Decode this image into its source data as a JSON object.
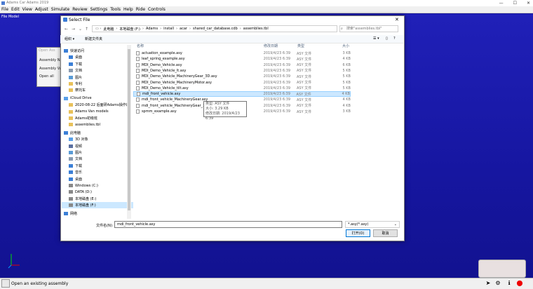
{
  "app": {
    "title": "Adams Car Adams 2019",
    "menu": [
      "File",
      "Edit",
      "View",
      "Adjust",
      "Simulate",
      "Review",
      "Settings",
      "Tools",
      "Help",
      "Ride",
      "Controls"
    ],
    "viewport_label": "File Model",
    "status_text": "Open an existing assembly"
  },
  "bg_dialog": {
    "title": "Open Ass",
    "line1": "Assembly Na",
    "line2": "Assembly Va",
    "line3": "Open all"
  },
  "dialog": {
    "title": "Select File",
    "breadcrumb": [
      "此电脑",
      "本地磁盘 (F:)",
      "Adams",
      "install",
      "acar",
      "shared_car_database.cdb",
      "assemblies.tbl"
    ],
    "search_placeholder": "搜索\"assemblies.tbl\"",
    "toolbar": {
      "organize": "组织 ▾",
      "new_folder": "新建文件夹"
    },
    "sidebar": [
      {
        "label": "快速访问",
        "icon": "star-icon"
      },
      {
        "label": "桌面",
        "icon": "desktop-icon"
      },
      {
        "label": "下载",
        "icon": "download-icon"
      },
      {
        "label": "文档",
        "icon": "document-icon"
      },
      {
        "label": "图片",
        "icon": "picture-icon"
      },
      {
        "label": "专利",
        "icon": "folder-icon"
      },
      {
        "label": "摩托车",
        "icon": "folder-icon"
      },
      {
        "label": "iCloud Drive",
        "icon": "cloud-icon"
      },
      {
        "label": "2020-08-22 后面研Adams操作的",
        "icon": "folder-icon"
      },
      {
        "label": "Adams Van models",
        "icon": "folder-icon"
      },
      {
        "label": "Adams初级班",
        "icon": "folder-icon"
      },
      {
        "label": "assemblies.tbl",
        "icon": "folder-icon"
      },
      {
        "label": "此电脑",
        "icon": "computer-icon"
      },
      {
        "label": "3D 对象",
        "icon": "cube-icon"
      },
      {
        "label": "视频",
        "icon": "video-icon"
      },
      {
        "label": "图片",
        "icon": "picture-icon"
      },
      {
        "label": "文档",
        "icon": "document-icon"
      },
      {
        "label": "下载",
        "icon": "download-icon"
      },
      {
        "label": "音乐",
        "icon": "music-icon"
      },
      {
        "label": "桌面",
        "icon": "desktop-icon"
      },
      {
        "label": "Windows (C:)",
        "icon": "drive-icon"
      },
      {
        "label": "DATA (D:)",
        "icon": "drive-icon"
      },
      {
        "label": "本地磁盘 (E:)",
        "icon": "drive-icon"
      },
      {
        "label": "本地磁盘 (F:)",
        "icon": "drive-icon"
      },
      {
        "label": "网络",
        "icon": "network-icon"
      }
    ],
    "columns": {
      "name": "名称",
      "date": "修改日期",
      "type": "类型",
      "size": "大小"
    },
    "files": [
      {
        "name": "actuation_example.asy",
        "date": "2019/4/23 6:39",
        "type": "ASY 文件",
        "size": "3 KB"
      },
      {
        "name": "leaf_spring_example.asy",
        "date": "2019/4/23 6:39",
        "type": "ASY 文件",
        "size": "4 KB"
      },
      {
        "name": "MDI_Demo_Vehicle.asy",
        "date": "2019/4/23 6:39",
        "type": "ASY 文件",
        "size": "6 KB"
      },
      {
        "name": "MDI_Demo_Vehicle_lt.asy",
        "date": "2019/4/23 6:39",
        "type": "ASY 文件",
        "size": "5 KB"
      },
      {
        "name": "MDI_Demo_Vehicle_MachineryGear_3D.asy",
        "date": "2019/4/23 6:39",
        "type": "ASY 文件",
        "size": "5 KB"
      },
      {
        "name": "MDI_Demo_Vehicle_MachineryMotor.asy",
        "date": "2019/4/23 6:39",
        "type": "ASY 文件",
        "size": "5 KB"
      },
      {
        "name": "MDI_Demo_Vehicle_tilt.asy",
        "date": "2019/4/23 6:39",
        "type": "ASY 文件",
        "size": "5 KB"
      },
      {
        "name": "mdi_front_vehicle.asy",
        "date": "2019/4/23 6:39",
        "type": "ASY 文件",
        "size": "4 KB"
      },
      {
        "name": "mdi_front_vehicle_MachineryGear.asy",
        "date": "2019/4/23 6:39",
        "type": "ASY 文件",
        "size": "4 KB"
      },
      {
        "name": "mdi_front_vehicle_MachineryGear_3D.asy",
        "date": "2019/4/23 6:39",
        "type": "ASY 文件",
        "size": "4 KB"
      },
      {
        "name": "spmm_example.asy",
        "date": "2019/4/23 6:39",
        "type": "ASY 文件",
        "size": "3 KB"
      }
    ],
    "selected_index": 7,
    "tooltip": [
      "类型: ASY 文件",
      "大小: 3.29 KB",
      "修改日期: 2019/4/23 6:39"
    ],
    "filename_label": "文件名(N):",
    "filename_value": "mdi_front_vehicle.asy",
    "filetype_value": "*.asy(*.asy)",
    "open_label": "打开(O)",
    "cancel_label": "取消"
  }
}
